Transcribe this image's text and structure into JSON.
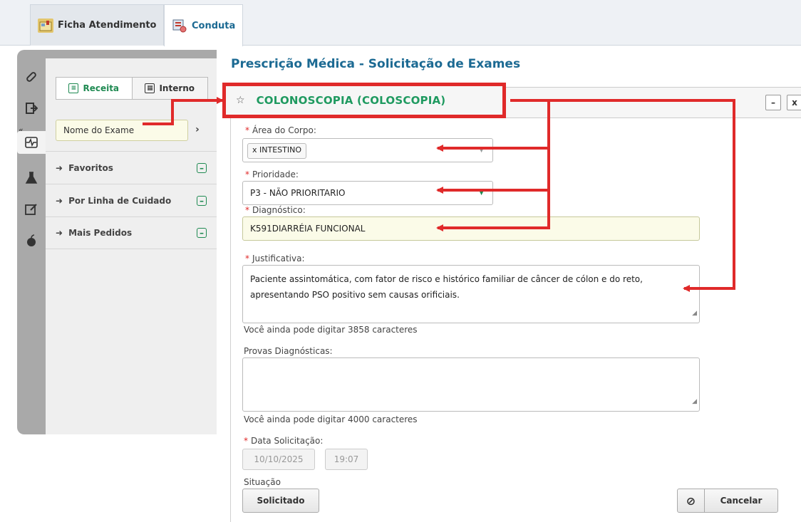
{
  "tabs": [
    {
      "label": "Ficha Atendimento",
      "icon": "ficha-icon",
      "active": false
    },
    {
      "label": "Conduta",
      "icon": "conduta-icon",
      "active": true
    }
  ],
  "rail": {
    "icons": [
      "pill-icon",
      "exit-icon",
      "ecg-icon",
      "flask-icon",
      "edit-icon",
      "apple-icon"
    ],
    "collapse_glyph": "«"
  },
  "left_panel": {
    "segment": {
      "receita_label": "Receita",
      "interno_label": "Interno"
    },
    "exam_name_placeholder": "Nome do Exame",
    "sections": [
      {
        "label": "Favoritos"
      },
      {
        "label": "Por Linha de Cuidado"
      },
      {
        "label": "Mais Pedidos"
      }
    ]
  },
  "main": {
    "title": "Prescrição Médica - Solicitação de Exames",
    "exam_name": "COLONOSCOPIA (COLOSCOPIA)",
    "fields": {
      "area_label": "Área do Corpo:",
      "area_value": "x INTESTINO",
      "prioridade_label": "Prioridade:",
      "prioridade_value": "P3 - NÃO PRIORITARIO",
      "diagnostico_label": "Diagnóstico:",
      "diagnostico_value": "K591DIARRÉIA FUNCIONAL",
      "justificativa_label": "Justificativa:",
      "justificativa_value": "Paciente assintomática, com fator de risco e histórico familiar de câncer de cólon e do reto, apresentando PSO positivo sem causas orificiais.",
      "justificativa_counter": "Você ainda pode digitar 3858 caracteres",
      "provas_label": "Provas Diagnósticas:",
      "provas_value": "",
      "provas_counter": "Você ainda pode digitar 4000 caracteres",
      "data_label": "Data Solicitação:",
      "date": "10/10/2025",
      "time": "19:07",
      "situacao_label": "Situação",
      "situacao_button": "Solicitado",
      "cancel_button": "Cancelar",
      "required_marker": "*"
    },
    "window_buttons": {
      "minimize": "–",
      "close": "x"
    }
  },
  "colors": {
    "annotation_red": "#e02a2a",
    "exam_green": "#1f9a60",
    "title_blue": "#1c6a93"
  }
}
